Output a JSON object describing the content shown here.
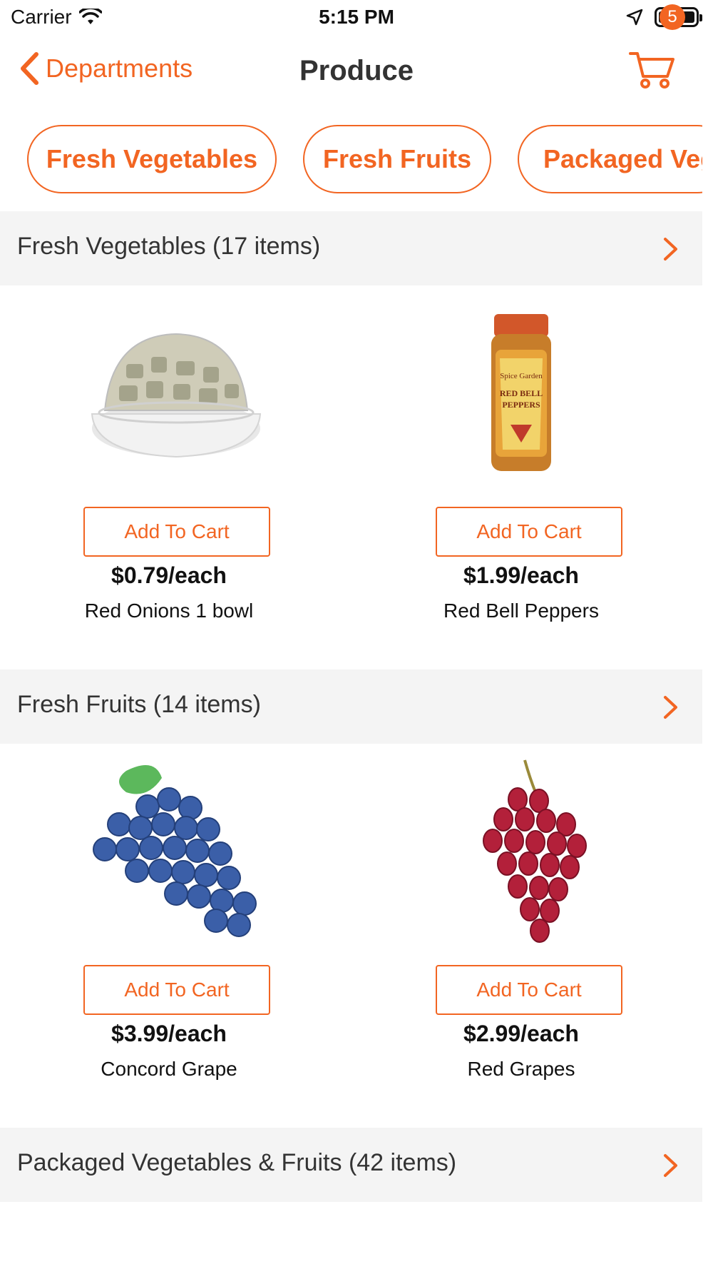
{
  "status_bar": {
    "carrier": "Carrier",
    "time": "5:15 PM"
  },
  "nav": {
    "back_label": "Departments",
    "title": "Produce",
    "cart_count": "5"
  },
  "chips": [
    "Fresh Vegetables",
    "Fresh Fruits",
    "Packaged Veg"
  ],
  "sections": [
    {
      "header": "Fresh Vegetables (17 items)",
      "products": [
        {
          "price": "$0.79/each",
          "name": "Red Onions 1 bowl",
          "button": "Add To Cart"
        },
        {
          "price": "$1.99/each",
          "name": "Red Bell Peppers",
          "button": "Add To Cart",
          "jar_text": "Spice Garden RED BELL PEPPERS"
        }
      ]
    },
    {
      "header": "Fresh Fruits (14 items)",
      "products": [
        {
          "price": "$3.99/each",
          "name": "Concord Grape",
          "button": "Add To Cart"
        },
        {
          "price": "$2.99/each",
          "name": "Red Grapes",
          "button": "Add To Cart"
        }
      ]
    },
    {
      "header": "Packaged Vegetables & Fruits (42 items)"
    }
  ],
  "colors": {
    "accent": "#f26522",
    "section_bg": "#f4f4f4",
    "grape_blue": "#3b5fa8",
    "grape_red": "#b3203a"
  }
}
